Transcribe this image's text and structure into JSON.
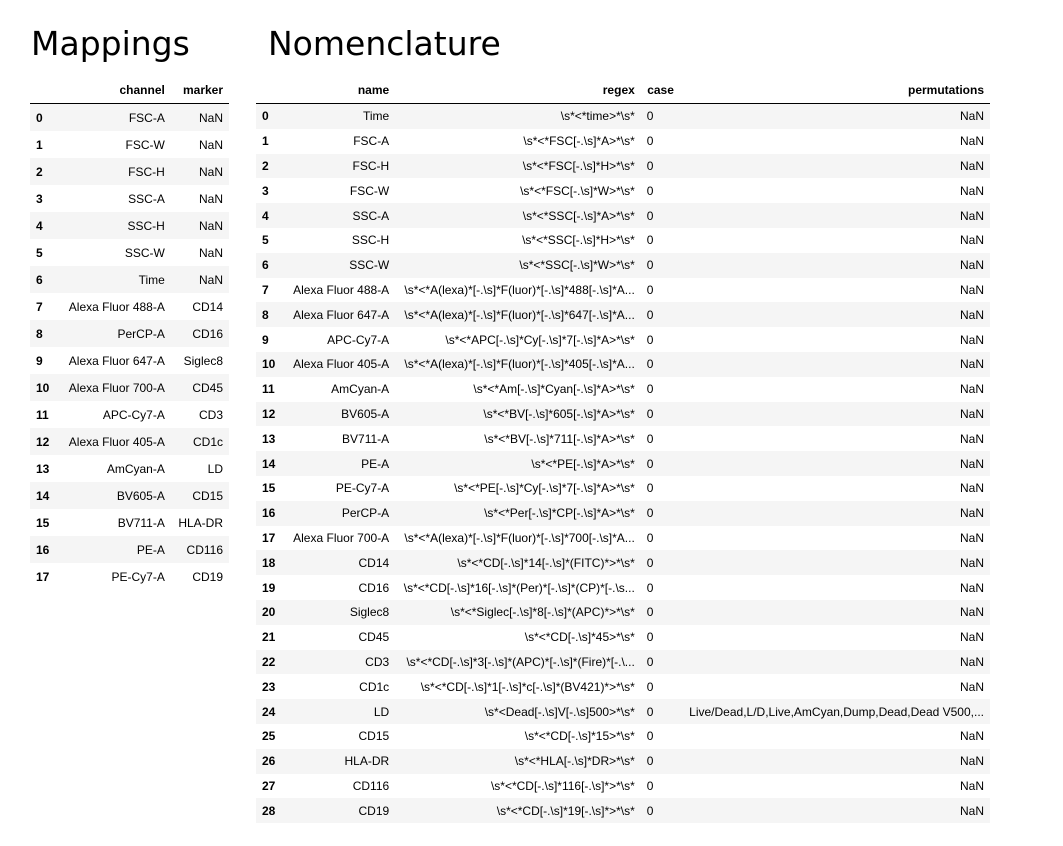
{
  "mappings": {
    "title": "Mappings",
    "columns": [
      "channel",
      "marker"
    ],
    "rows": [
      {
        "idx": "0",
        "channel": "FSC-A",
        "marker": "NaN"
      },
      {
        "idx": "1",
        "channel": "FSC-W",
        "marker": "NaN"
      },
      {
        "idx": "2",
        "channel": "FSC-H",
        "marker": "NaN"
      },
      {
        "idx": "3",
        "channel": "SSC-A",
        "marker": "NaN"
      },
      {
        "idx": "4",
        "channel": "SSC-H",
        "marker": "NaN"
      },
      {
        "idx": "5",
        "channel": "SSC-W",
        "marker": "NaN"
      },
      {
        "idx": "6",
        "channel": "Time",
        "marker": "NaN"
      },
      {
        "idx": "7",
        "channel": "Alexa Fluor 488-A",
        "marker": "CD14"
      },
      {
        "idx": "8",
        "channel": "PerCP-A",
        "marker": "CD16"
      },
      {
        "idx": "9",
        "channel": "Alexa Fluor 647-A",
        "marker": "Siglec8"
      },
      {
        "idx": "10",
        "channel": "Alexa Fluor 700-A",
        "marker": "CD45"
      },
      {
        "idx": "11",
        "channel": "APC-Cy7-A",
        "marker": "CD3"
      },
      {
        "idx": "12",
        "channel": "Alexa Fluor 405-A",
        "marker": "CD1c"
      },
      {
        "idx": "13",
        "channel": "AmCyan-A",
        "marker": "LD"
      },
      {
        "idx": "14",
        "channel": "BV605-A",
        "marker": "CD15"
      },
      {
        "idx": "15",
        "channel": "BV711-A",
        "marker": "HLA-DR"
      },
      {
        "idx": "16",
        "channel": "PE-A",
        "marker": "CD116"
      },
      {
        "idx": "17",
        "channel": "PE-Cy7-A",
        "marker": "CD19"
      }
    ]
  },
  "nomenclature": {
    "title": "Nomenclature",
    "columns": [
      "name",
      "regex",
      "case",
      "permutations"
    ],
    "rows": [
      {
        "idx": "0",
        "name": "Time",
        "regex": "\\s*<*time>*\\s*",
        "case": "0",
        "permutations": "NaN"
      },
      {
        "idx": "1",
        "name": "FSC-A",
        "regex": "\\s*<*FSC[-.\\s]*A>*\\s*",
        "case": "0",
        "permutations": "NaN"
      },
      {
        "idx": "2",
        "name": "FSC-H",
        "regex": "\\s*<*FSC[-.\\s]*H>*\\s*",
        "case": "0",
        "permutations": "NaN"
      },
      {
        "idx": "3",
        "name": "FSC-W",
        "regex": "\\s*<*FSC[-.\\s]*W>*\\s*",
        "case": "0",
        "permutations": "NaN"
      },
      {
        "idx": "4",
        "name": "SSC-A",
        "regex": "\\s*<*SSC[-.\\s]*A>*\\s*",
        "case": "0",
        "permutations": "NaN"
      },
      {
        "idx": "5",
        "name": "SSC-H",
        "regex": "\\s*<*SSC[-.\\s]*H>*\\s*",
        "case": "0",
        "permutations": "NaN"
      },
      {
        "idx": "6",
        "name": "SSC-W",
        "regex": "\\s*<*SSC[-.\\s]*W>*\\s*",
        "case": "0",
        "permutations": "NaN"
      },
      {
        "idx": "7",
        "name": "Alexa Fluor 488-A",
        "regex": "\\s*<*A(lexa)*[-.\\s]*F(luor)*[-.\\s]*488[-.\\s]*A...",
        "case": "0",
        "permutations": "NaN"
      },
      {
        "idx": "8",
        "name": "Alexa Fluor 647-A",
        "regex": "\\s*<*A(lexa)*[-.\\s]*F(luor)*[-.\\s]*647[-.\\s]*A...",
        "case": "0",
        "permutations": "NaN"
      },
      {
        "idx": "9",
        "name": "APC-Cy7-A",
        "regex": "\\s*<*APC[-.\\s]*Cy[-.\\s]*7[-.\\s]*A>*\\s*",
        "case": "0",
        "permutations": "NaN"
      },
      {
        "idx": "10",
        "name": "Alexa Fluor 405-A",
        "regex": "\\s*<*A(lexa)*[-.\\s]*F(luor)*[-.\\s]*405[-.\\s]*A...",
        "case": "0",
        "permutations": "NaN"
      },
      {
        "idx": "11",
        "name": "AmCyan-A",
        "regex": "\\s*<*Am[-.\\s]*Cyan[-.\\s]*A>*\\s*",
        "case": "0",
        "permutations": "NaN"
      },
      {
        "idx": "12",
        "name": "BV605-A",
        "regex": "\\s*<*BV[-.\\s]*605[-.\\s]*A>*\\s*",
        "case": "0",
        "permutations": "NaN"
      },
      {
        "idx": "13",
        "name": "BV711-A",
        "regex": "\\s*<*BV[-.\\s]*711[-.\\s]*A>*\\s*",
        "case": "0",
        "permutations": "NaN"
      },
      {
        "idx": "14",
        "name": "PE-A",
        "regex": "\\s*<*PE[-.\\s]*A>*\\s*",
        "case": "0",
        "permutations": "NaN"
      },
      {
        "idx": "15",
        "name": "PE-Cy7-A",
        "regex": "\\s*<*PE[-.\\s]*Cy[-.\\s]*7[-.\\s]*A>*\\s*",
        "case": "0",
        "permutations": "NaN"
      },
      {
        "idx": "16",
        "name": "PerCP-A",
        "regex": "\\s*<*Per[-.\\s]*CP[-.\\s]*A>*\\s*",
        "case": "0",
        "permutations": "NaN"
      },
      {
        "idx": "17",
        "name": "Alexa Fluor 700-A",
        "regex": "\\s*<*A(lexa)*[-.\\s]*F(luor)*[-.\\s]*700[-.\\s]*A...",
        "case": "0",
        "permutations": "NaN"
      },
      {
        "idx": "18",
        "name": "CD14",
        "regex": "\\s*<*CD[-.\\s]*14[-.\\s]*(FITC)*>*\\s*",
        "case": "0",
        "permutations": "NaN"
      },
      {
        "idx": "19",
        "name": "CD16",
        "regex": "\\s*<*CD[-.\\s]*16[-.\\s]*(Per)*[-.\\s]*(CP)*[-.\\s...",
        "case": "0",
        "permutations": "NaN"
      },
      {
        "idx": "20",
        "name": "Siglec8",
        "regex": "\\s*<*Siglec[-.\\s]*8[-.\\s]*(APC)*>*\\s*",
        "case": "0",
        "permutations": "NaN"
      },
      {
        "idx": "21",
        "name": "CD45",
        "regex": "\\s*<*CD[-.\\s]*45>*\\s*",
        "case": "0",
        "permutations": "NaN"
      },
      {
        "idx": "22",
        "name": "CD3",
        "regex": "\\s*<*CD[-.\\s]*3[-.\\s]*(APC)*[-.\\s]*(Fire)*[-.\\...",
        "case": "0",
        "permutations": "NaN"
      },
      {
        "idx": "23",
        "name": "CD1c",
        "regex": "\\s*<*CD[-.\\s]*1[-.\\s]*c[-.\\s]*(BV421)*>*\\s*",
        "case": "0",
        "permutations": "NaN"
      },
      {
        "idx": "24",
        "name": "LD",
        "regex": "\\s*<Dead[-.\\s]V[-.\\s]500>*\\s*",
        "case": "0",
        "permutations": "Live/Dead,L/D,Live,AmCyan,Dump,Dead,Dead V500,..."
      },
      {
        "idx": "25",
        "name": "CD15",
        "regex": "\\s*<*CD[-.\\s]*15>*\\s*",
        "case": "0",
        "permutations": "NaN"
      },
      {
        "idx": "26",
        "name": "HLA-DR",
        "regex": "\\s*<*HLA[-.\\s]*DR>*\\s*",
        "case": "0",
        "permutations": "NaN"
      },
      {
        "idx": "27",
        "name": "CD116",
        "regex": "\\s*<*CD[-.\\s]*116[-.\\s]*>*\\s*",
        "case": "0",
        "permutations": "NaN"
      },
      {
        "idx": "28",
        "name": "CD19",
        "regex": "\\s*<*CD[-.\\s]*19[-.\\s]*>*\\s*",
        "case": "0",
        "permutations": "NaN"
      }
    ]
  }
}
